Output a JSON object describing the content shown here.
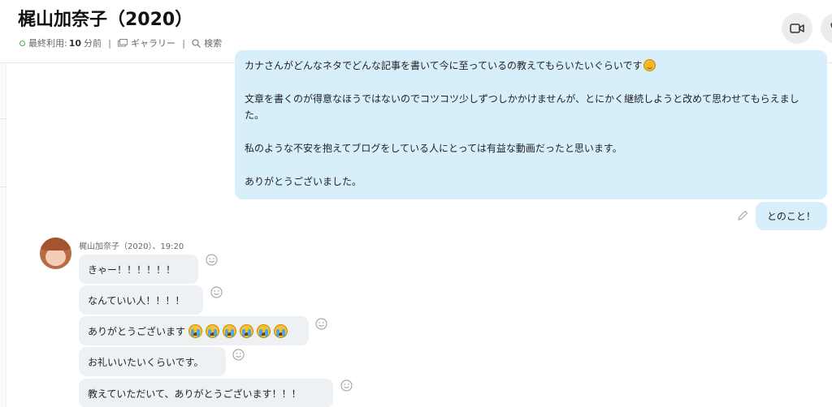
{
  "header": {
    "title": "梶山加奈子（2020）",
    "last_used_label": "最終利用:",
    "last_used_value": "10",
    "last_used_unit": "分前",
    "gallery_label": "ギャラリー",
    "search_label": "検索",
    "separator": "|"
  },
  "outgoing": {
    "long_message_paragraphs": [
      "カナさんがどんなネタでどんな記事を書いて今に至っているの教えてもらいたいぐらいです",
      "文章を書くのが得意なほうではないのでコツコツ少しずつしかかけませんが、とにかく継続しようと改めて思わせてもらえました。",
      "私のような不安を抱えてブログをしている人にとっては有益な動画だったと思います。",
      "ありがとうございました。"
    ],
    "short_message": "とのこと！"
  },
  "incoming": {
    "sender_line": "梶山加奈子（2020）、19:20",
    "messages": [
      "きゃー！！！！！！",
      "なんていい人！！！！",
      "ありがとうございます",
      "お礼いいたいくらいです。",
      "教えていただいて、ありがとうございます！！！"
    ]
  },
  "colors": {
    "outgoing_bubble": "#d6effb",
    "incoming_bubble": "#eef1f4",
    "status_online": "#4caf50"
  },
  "icons": {
    "video_call": "video-camera-icon",
    "voice_call": "phone-icon",
    "gallery": "gallery-icon",
    "search": "search-icon",
    "edit": "pencil-icon",
    "reaction": "smiley-icon",
    "emoji_sweat_smile": "smile-emoji-icon",
    "emoji_crying": "crying-emoji-icon"
  }
}
